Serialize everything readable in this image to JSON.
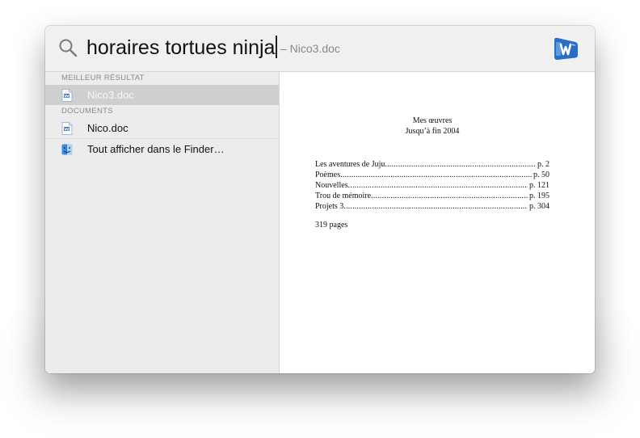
{
  "search": {
    "query": "horaires tortues ninja",
    "suffix": "– Nico3.doc"
  },
  "results": {
    "sections": [
      {
        "header": "MEILLEUR RÉSULTAT",
        "items": [
          {
            "label": "Nico3.doc",
            "icon": "word-document-icon",
            "selected": true
          }
        ]
      },
      {
        "header": "DOCUMENTS",
        "items": [
          {
            "label": "Nico.doc",
            "icon": "word-document-icon",
            "selected": false
          },
          {
            "label": "Tout afficher dans le Finder…",
            "icon": "finder-icon",
            "selected": false
          }
        ]
      }
    ]
  },
  "preview": {
    "title_line1": "Mes œuvres",
    "title_line2": "Jusqu’à fin 2004",
    "toc": [
      {
        "label": "Les aventures de Juju",
        "page": "p. 2"
      },
      {
        "label": "Poèmes",
        "page": "p. 50"
      },
      {
        "label": "Nouvelles",
        "page": "p. 121"
      },
      {
        "label": "Trou de mémoire",
        "page": "p. 195"
      },
      {
        "label": "Projets 3",
        "page": "p. 304"
      }
    ],
    "total_pages": "319 pages"
  },
  "colors": {
    "selection": "#cfcfcf",
    "word_blue": "#2b6cc4",
    "finder_blue": "#3a8ee6"
  }
}
